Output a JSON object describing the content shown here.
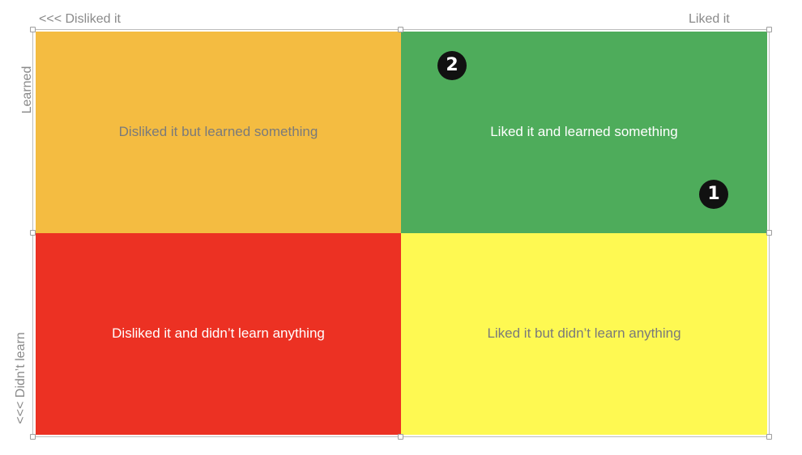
{
  "axes": {
    "x_left": "<<< Disliked it",
    "x_right": "Liked it",
    "x_right_arrow": ">>>",
    "y_top": "Learned",
    "y_top_arrow": ">>>",
    "y_bottom": "<<< Didn’t learn"
  },
  "quadrants": {
    "top_left": {
      "label": "Disliked it but learned something",
      "color": "#F4BC41",
      "text_color": "#7a7a7a"
    },
    "top_right": {
      "label": "Liked it and learned something",
      "color": "#4EAC5B",
      "text_color": "#ffffff"
    },
    "bottom_left": {
      "label": "Disliked it and didn’t learn anything",
      "color": "#EC3123",
      "text_color": "#ffffff"
    },
    "bottom_right": {
      "label": "Liked it but didn’t learn anything",
      "color": "#FEF952",
      "text_color": "#7a7a7a"
    }
  },
  "markers": {
    "one": "1",
    "two": "2"
  }
}
